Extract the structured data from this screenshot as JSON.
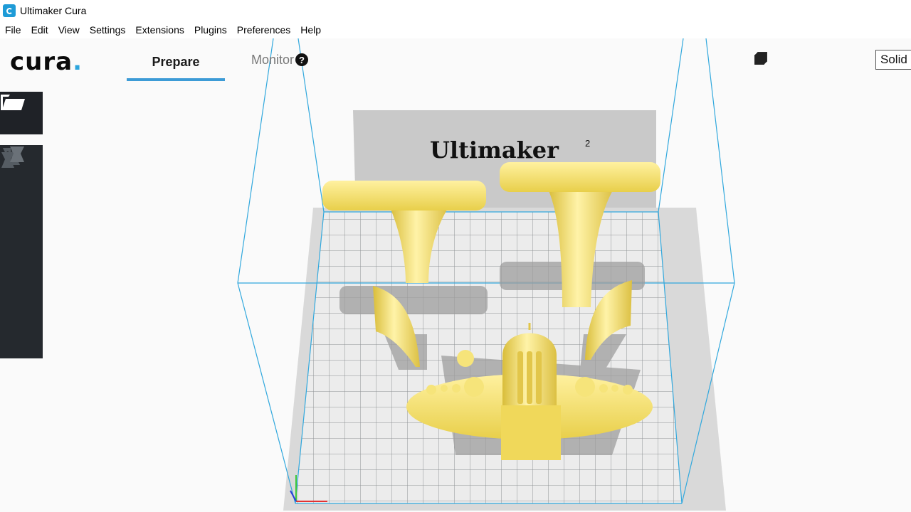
{
  "window": {
    "title": "Ultimaker Cura"
  },
  "menu": [
    "File",
    "Edit",
    "View",
    "Settings",
    "Extensions",
    "Plugins",
    "Preferences",
    "Help"
  ],
  "header": {
    "logo": "cura",
    "logo_dot": ".",
    "tabs": [
      {
        "label": "Prepare",
        "active": true
      },
      {
        "label": "Monitor",
        "active": false
      }
    ],
    "help_icon": "?"
  },
  "view": {
    "buttons": [
      "3d-view-icon",
      "front-view-icon",
      "top-view-icon",
      "left-view-icon",
      "right-view-icon"
    ],
    "mode": "Solid"
  },
  "toolbar": {
    "open_icon": "folder-open-icon",
    "tools": [
      "move-icon",
      "scale-icon",
      "rotate-icon",
      "mirror-icon",
      "per-model-settings-icon"
    ]
  },
  "scene": {
    "printer_brand": "Ultimaker",
    "printer_model_sup": "2"
  },
  "colors": {
    "accent": "#3c9bd6",
    "model": "#f4e36b",
    "toolbar": "#25292e",
    "build_volume": "#31a8dd"
  }
}
